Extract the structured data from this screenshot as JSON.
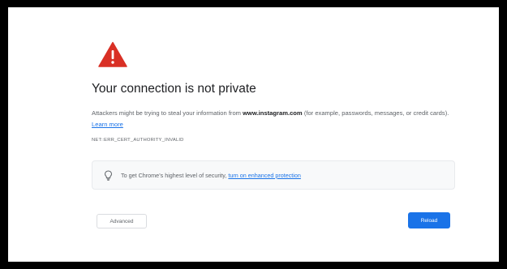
{
  "page": {
    "title": "Your connection is not private",
    "description_part1": "Attackers might be trying to steal your information from ",
    "domain": "www.instagram.com",
    "description_part2": " (for example, passwords, messages, or credit cards). ",
    "learn_more_label": "Learn more",
    "error_code": "NET::ERR_CERT_AUTHORITY_INVALID"
  },
  "tip": {
    "text": "To get Chrome’s highest level of security, ",
    "link_label": "turn on enhanced protection"
  },
  "buttons": {
    "advanced_label": "Advanced",
    "reload_label": "Reload"
  },
  "colors": {
    "warning": "#d93025",
    "link": "#1a73e8",
    "primary_button": "#1a73e8"
  },
  "icons": {
    "warning": "warning-triangle-icon",
    "tip": "lightbulb-icon"
  }
}
